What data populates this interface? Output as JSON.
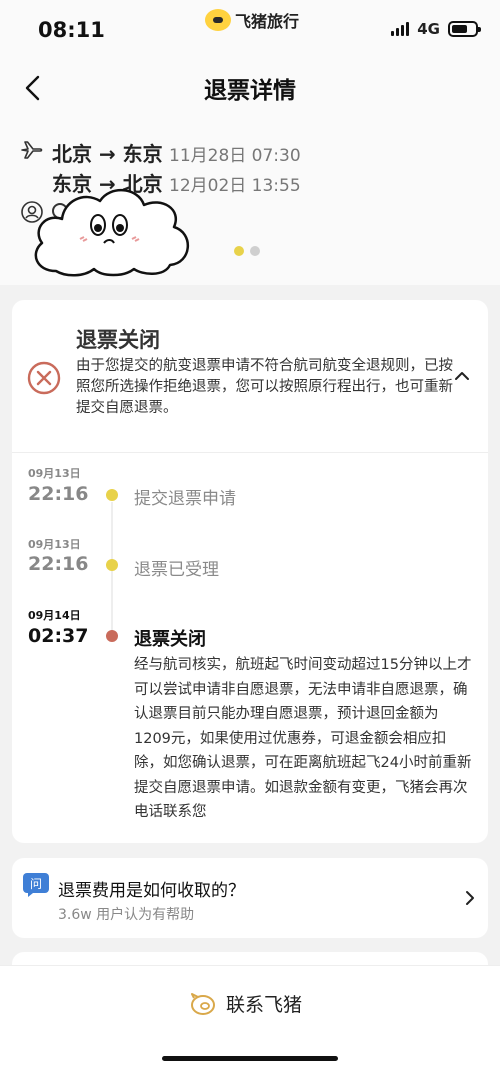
{
  "status_bar": {
    "time": "08:11",
    "brand": "飞猪旅行",
    "network": "4G"
  },
  "nav": {
    "title": "退票详情"
  },
  "flights": [
    {
      "route": "北京 → 东京",
      "datetime": "11月28日 07:30"
    },
    {
      "route": "东京 → 北京",
      "datetime": "12月02日 13:55"
    }
  ],
  "refund_status": {
    "title": "退票关闭",
    "description": "由于您提交的航变退票申请不符合航司航变全退规则，已按照您所选操作拒绝退票，您可以按照原行程出行，也可重新提交自愿退票。"
  },
  "timeline": [
    {
      "date": "09月13日",
      "time": "22:16",
      "label": "提交退票申请"
    },
    {
      "date": "09月13日",
      "time": "22:16",
      "label": "退票已受理"
    },
    {
      "date": "09月14日",
      "time": "02:37",
      "label": "退票关闭",
      "detail": "经与航司核实，航班起飞时间变动超过15分钟以上才可以尝试申请非自愿退票，无法申请非自愿退票，确认退票目前只能办理自愿退票，预计退回金额为1209元，如果使用过优惠券，可退金额会相应扣除，如您确认退票，可在距离航班起飞24小时前重新提交自愿退票申请。如退款金额有变更，飞猪会再次电话联系您"
    }
  ],
  "faq": {
    "badge": "问",
    "title": "退票费用是如何收取的？",
    "helpful": "3.6w 用户认为有帮助"
  },
  "footer": {
    "contact_label": "联系飞猪"
  },
  "colors": {
    "accent_yellow": "#e8d24a",
    "closed_red": "#c96b5b",
    "faq_blue": "#3f7fd6"
  },
  "icons": [
    "back-arrow-icon",
    "plane-icon",
    "person-icon",
    "close-circle-icon",
    "chevron-up-icon",
    "question-icon",
    "chevron-right-icon",
    "pig-service-icon"
  ]
}
